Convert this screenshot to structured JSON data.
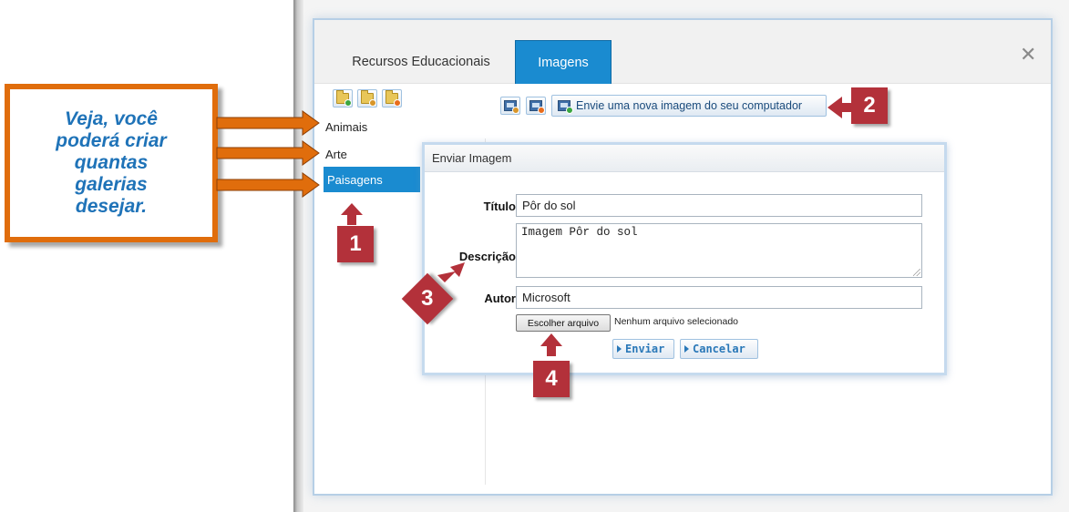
{
  "callout": {
    "lines": [
      "Veja, você",
      "poderá criar",
      "quantas",
      "galerias",
      "desejar."
    ]
  },
  "tabs": [
    {
      "label": "Recursos Educacionais",
      "active": false
    },
    {
      "label": "Imagens",
      "active": true
    }
  ],
  "toolbar": {
    "gallery_icons": [
      "folder-add-icon",
      "folder-edit-icon",
      "folder-delete-icon"
    ],
    "image_icons": [
      "image-edit-icon",
      "image-delete-icon"
    ],
    "upload_label": "Envie uma nova imagem do seu computador"
  },
  "galleries": [
    {
      "label": "Animais",
      "selected": false
    },
    {
      "label": "Arte",
      "selected": false
    },
    {
      "label": "Paisagens",
      "selected": true
    }
  ],
  "dialog": {
    "title": "Enviar Imagem",
    "titulo_label": "Título",
    "titulo_value": "Pôr do sol",
    "descricao_label": "Descrição",
    "descricao_value": "Imagem Pôr do sol",
    "autor_label": "Autor",
    "autor_value": "Microsoft",
    "file_button": "Escolher arquivo",
    "file_status": "Nenhum arquivo selecionado",
    "submit_label": "Enviar",
    "cancel_label": "Cancelar"
  },
  "markers": [
    "1",
    "2",
    "3",
    "4"
  ],
  "colors": {
    "callout_border": "#e06d0c",
    "callout_text": "#1f73b8",
    "accent_blue": "#1a8bd0",
    "marker_red": "#b3313a"
  }
}
